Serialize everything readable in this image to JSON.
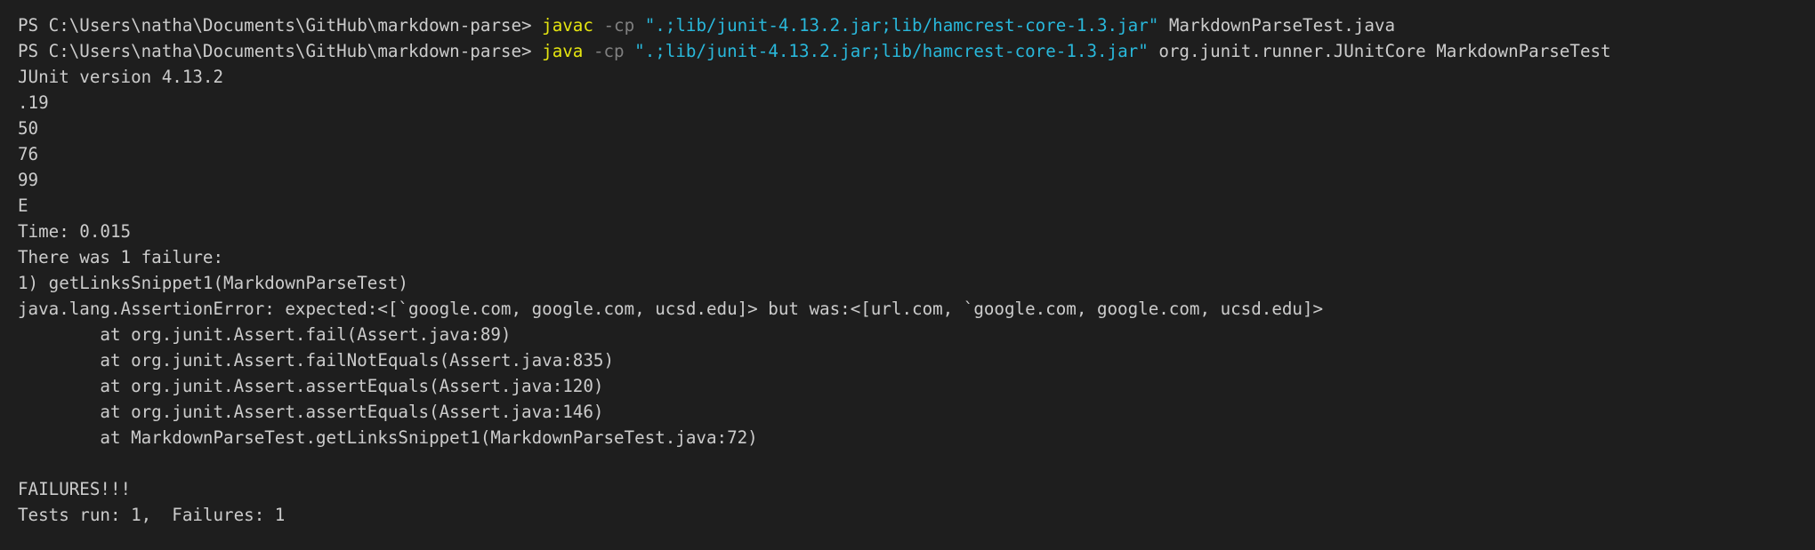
{
  "terminal": {
    "prompt": "PS C:\\Users\\natha\\Documents\\GitHub\\markdown-parse> ",
    "command1": {
      "cmd": "javac",
      "flag": "-cp",
      "classpath": "\".;lib/junit-4.13.2.jar;lib/hamcrest-core-1.3.jar\"",
      "args": "MarkdownParseTest.java"
    },
    "command2": {
      "cmd": "java",
      "flag": "-cp",
      "classpath": "\".;lib/junit-4.13.2.jar;lib/hamcrest-core-1.3.jar\"",
      "args": "org.junit.runner.JUnitCore MarkdownParseTest"
    },
    "output": [
      "JUnit version 4.13.2",
      ".19",
      "50",
      "76",
      "99",
      "E",
      "Time: 0.015",
      "There was 1 failure:",
      "1) getLinksSnippet1(MarkdownParseTest)",
      "java.lang.AssertionError: expected:<[`google.com, google.com, ucsd.edu]> but was:<[url.com, `google.com, google.com, ucsd.edu]>",
      "        at org.junit.Assert.fail(Assert.java:89)",
      "        at org.junit.Assert.failNotEquals(Assert.java:835)",
      "        at org.junit.Assert.assertEquals(Assert.java:120)",
      "        at org.junit.Assert.assertEquals(Assert.java:146)",
      "        at MarkdownParseTest.getLinksSnippet1(MarkdownParseTest.java:72)",
      "",
      "FAILURES!!!",
      "Tests run: 1,  Failures: 1"
    ]
  },
  "colors": {
    "background": "#1e1e1e",
    "text": "#cccccc",
    "command": "#e5e510",
    "flag": "#808080",
    "string": "#29b8db"
  }
}
